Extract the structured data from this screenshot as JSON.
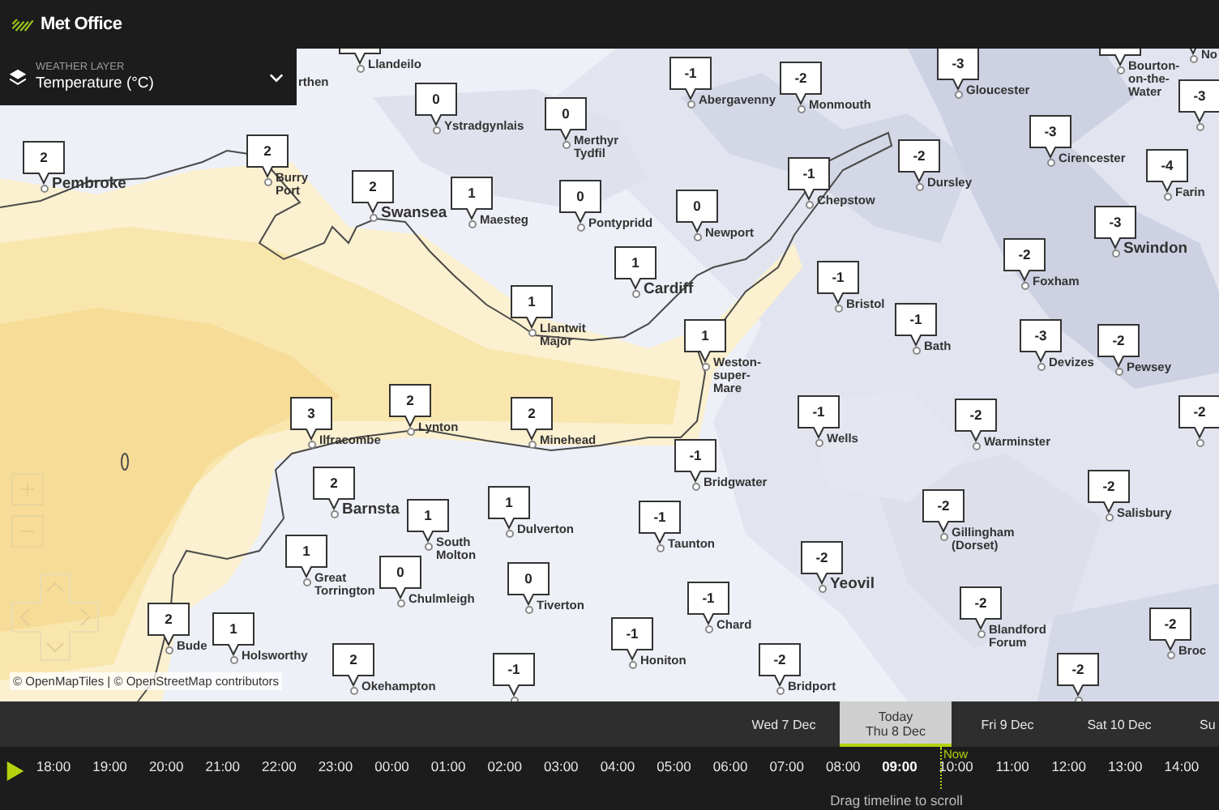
{
  "header": {
    "brand": "Met Office"
  },
  "layer_selector": {
    "label": "WEATHER LAYER",
    "value": "Temperature (°C)"
  },
  "map": {
    "markers": [
      {
        "name": "Llandeilo",
        "kind": "minor"
      },
      {
        "name": "rthen",
        "kind": "minor"
      },
      {
        "value": "0",
        "name": "Ystradgynlais",
        "kind": "minor"
      },
      {
        "value": "0",
        "name": "Merthyr Tydfil",
        "kind": "minor"
      },
      {
        "value": "2",
        "name": "Pembroke",
        "kind": "major"
      },
      {
        "value": "2",
        "name": "Burry Port",
        "kind": "minor"
      },
      {
        "value": "2",
        "name": "Swansea",
        "kind": "major"
      },
      {
        "value": "1",
        "name": "Maesteg",
        "kind": "minor"
      },
      {
        "value": "0",
        "name": "Pontypridd",
        "kind": "minor"
      },
      {
        "value": "1",
        "name": "Llantwit Major",
        "kind": "minor"
      },
      {
        "value": "-1",
        "name": "Abergavenny",
        "kind": "minor"
      },
      {
        "value": "-2",
        "name": "Monmouth",
        "kind": "minor"
      },
      {
        "value": "-3",
        "name": "Gloucester",
        "kind": "minor"
      },
      {
        "name": "Bourton-on-the-Water",
        "kind": "minor"
      },
      {
        "name": "No",
        "kind": "minor"
      },
      {
        "value": "-3"
      },
      {
        "value": "-1",
        "name": "Chepstow",
        "kind": "minor"
      },
      {
        "value": "0",
        "name": "Newport",
        "kind": "minor"
      },
      {
        "value": "1",
        "name": "Cardiff",
        "kind": "major"
      },
      {
        "value": "-2",
        "name": "Dursley",
        "kind": "minor"
      },
      {
        "value": "-3",
        "name": "Cirencester",
        "kind": "minor"
      },
      {
        "value": "-4",
        "name": "Farin",
        "kind": "minor"
      },
      {
        "value": "-3",
        "name": "Swindon",
        "kind": "major"
      },
      {
        "value": "-2",
        "name": "Foxham",
        "kind": "minor"
      },
      {
        "value": "-1",
        "name": "Bristol",
        "kind": "minor"
      },
      {
        "value": "-1",
        "name": "Bath",
        "kind": "minor"
      },
      {
        "value": "1",
        "name": "Weston-super-Mare",
        "kind": "minor"
      },
      {
        "value": "-3",
        "name": "Devizes",
        "kind": "minor"
      },
      {
        "value": "-2",
        "name": "Pewsey",
        "kind": "minor"
      },
      {
        "value": "3",
        "name": "Ilfracombe",
        "kind": "minor"
      },
      {
        "value": "2",
        "name": "Lynton",
        "kind": "minor"
      },
      {
        "value": "2",
        "name": "Minehead",
        "kind": "minor"
      },
      {
        "value": "-1",
        "name": "Wells",
        "kind": "minor"
      },
      {
        "value": "-2",
        "name": "Warminster",
        "kind": "minor"
      },
      {
        "value": "-2"
      },
      {
        "value": "-1",
        "name": "Bridgwater",
        "kind": "minor"
      },
      {
        "value": "2",
        "name": "Barnsta",
        "kind": "major"
      },
      {
        "value": "1",
        "name": "South Molton",
        "kind": "minor"
      },
      {
        "value": "1",
        "name": "Dulverton",
        "kind": "minor"
      },
      {
        "value": "-1",
        "name": "Taunton",
        "kind": "minor"
      },
      {
        "value": "-2",
        "name": "Gillingham (Dorset)",
        "kind": "minor"
      },
      {
        "value": "-2",
        "name": "Salisbury",
        "kind": "minor"
      },
      {
        "value": "1",
        "name": "Great Torrington",
        "kind": "minor"
      },
      {
        "value": "0",
        "name": "Chulmleigh",
        "kind": "minor"
      },
      {
        "value": "0",
        "name": "Tiverton",
        "kind": "minor"
      },
      {
        "value": "-2",
        "name": "Yeovil",
        "kind": "major"
      },
      {
        "value": "2",
        "name": "Bude",
        "kind": "minor"
      },
      {
        "value": "1",
        "name": "Holsworthy",
        "kind": "minor"
      },
      {
        "value": "-1",
        "name": "Honiton",
        "kind": "minor"
      },
      {
        "value": "-1",
        "name": "Chard",
        "kind": "minor"
      },
      {
        "value": "-2",
        "name": "Blandford Forum",
        "kind": "minor"
      },
      {
        "value": "-2",
        "name": "Broc",
        "kind": "minor"
      },
      {
        "value": "2",
        "name": "Okehampton",
        "kind": "minor"
      },
      {
        "value": "-1"
      },
      {
        "value": "-2",
        "name": "Bridport",
        "kind": "minor"
      },
      {
        "value": "-2"
      }
    ],
    "attribution": "© OpenMapTiles | © OpenStreetMap contributors"
  },
  "timeline": {
    "days": [
      {
        "label": "Wed 7 Dec",
        "selected": false
      },
      {
        "caption": "Today",
        "label": "Thu 8 Dec",
        "selected": true
      },
      {
        "label": "Fri 9 Dec",
        "selected": false
      },
      {
        "label": "Sat 10 Dec",
        "selected": false
      },
      {
        "label": "Su",
        "selected": false
      }
    ],
    "hours": [
      {
        "label": "18:00",
        "selected": false
      },
      {
        "label": "19:00",
        "selected": false
      },
      {
        "label": "20:00",
        "selected": false
      },
      {
        "label": "21:00",
        "selected": false
      },
      {
        "label": "22:00",
        "selected": false
      },
      {
        "label": "23:00",
        "selected": false
      },
      {
        "label": "00:00",
        "selected": false
      },
      {
        "label": "01:00",
        "selected": false
      },
      {
        "label": "02:00",
        "selected": false
      },
      {
        "label": "03:00",
        "selected": false
      },
      {
        "label": "04:00",
        "selected": false
      },
      {
        "label": "05:00",
        "selected": false
      },
      {
        "label": "06:00",
        "selected": false
      },
      {
        "label": "07:00",
        "selected": false
      },
      {
        "label": "08:00",
        "selected": false
      },
      {
        "label": "09:00",
        "selected": true
      },
      {
        "label": "10:00",
        "selected": false
      },
      {
        "label": "11:00",
        "selected": false
      },
      {
        "label": "12:00",
        "selected": false
      },
      {
        "label": "13:00",
        "selected": false
      },
      {
        "label": "14:00",
        "selected": false
      }
    ],
    "now_label": "Now",
    "hint": "Drag timeline to scroll"
  }
}
